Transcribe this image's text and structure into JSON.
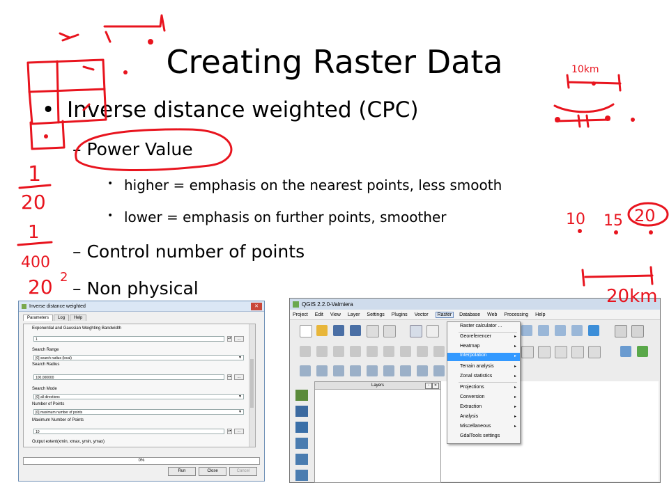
{
  "slide": {
    "title": "Creating Raster Data",
    "bullet1": "Inverse distance weighted (CPC)",
    "sub1": "– Power Value",
    "sub1a": "higher = emphasis on the nearest points, less smooth",
    "sub1b": "lower = emphasis on further points, smoother",
    "sub2": "– Control number of points",
    "sub3": "– Non physical"
  },
  "handwriting": {
    "fraction1_num": "1",
    "fraction1_den": "20",
    "fraction2_num": "1",
    "fraction2_den": "400",
    "squared": "20",
    "exponent": "2",
    "scale_top": "10km",
    "scale_bottom": "20km",
    "powers": [
      "10",
      "15",
      "20"
    ]
  },
  "idw_dialog": {
    "title": "Inverse distance weighted",
    "tabs": [
      "Parameters",
      "Log",
      "Help"
    ],
    "bandwidth_label": "Exponential and Gaussian Weighting Bandwidth",
    "bandwidth_value": "1",
    "search_range_label": "Search Range",
    "search_range_value": "[0] search radius (local)",
    "search_radius_label": "Search Radius",
    "search_radius_value": "100.000000",
    "search_mode_label": "Search Mode",
    "search_mode_value": "[0] all directions",
    "num_points_label": "Number of Points",
    "num_points_value": "[0] maximum number of points",
    "max_points_label": "Maximum Number of Points",
    "max_points_value": "10",
    "output_extent_label": "Output extent(xmin, xmax, ymin, ymax)",
    "progress": "0%",
    "buttons": [
      "Run",
      "Close",
      "Cancel"
    ]
  },
  "qgis": {
    "title": "QGIS 2.2.0-Valmiera",
    "menu": [
      "Project",
      "Edit",
      "View",
      "Layer",
      "Settings",
      "Plugins",
      "Vector",
      "Raster",
      "Database",
      "Web",
      "Processing",
      "Help"
    ],
    "layers_panel": "Layers",
    "raster_menu": {
      "calculator": "Raster calculator ...",
      "items": [
        "Georeferencer",
        "Heatmap",
        "Interpolation",
        "Terrain analysis",
        "Zonal statistics",
        "Projections",
        "Conversion",
        "Extraction",
        "Analysis",
        "Miscellaneous",
        "GdalTools settings"
      ]
    }
  },
  "colors": {
    "ink": "#e8141e",
    "highlight": "#3399ff"
  }
}
